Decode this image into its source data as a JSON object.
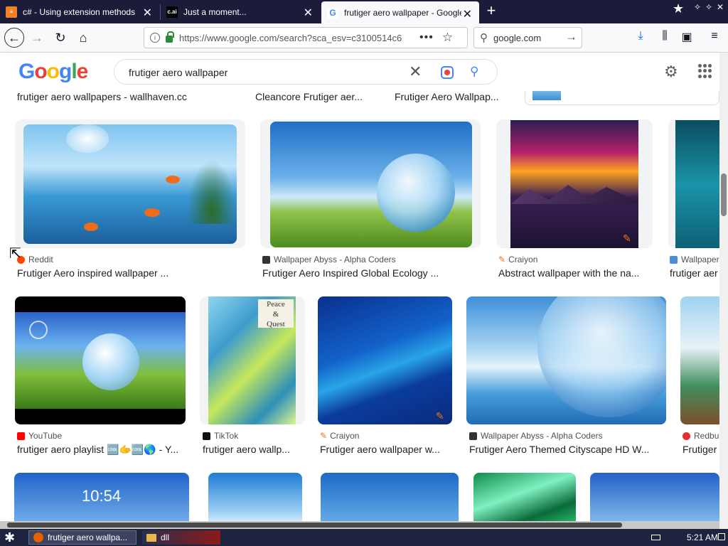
{
  "tabs": [
    {
      "title": "c# - Using extension methods in .N",
      "favicon": "stackoverflow-icon"
    },
    {
      "title": "Just a moment...",
      "favicon": "cai-icon",
      "fav_text": "c.ai"
    },
    {
      "title": "frutiger aero wallpaper - Google Se",
      "favicon": "google-icon",
      "active": true
    }
  ],
  "nav": {
    "url": "https://www.google.com/search?sca_esv=c3100514c6",
    "search_engine": "google.com"
  },
  "google": {
    "logo": "Google",
    "query": "frutiger aero wallpaper"
  },
  "top_row_captions": [
    "frutiger aero wallpapers - wallhaven.cc",
    "Cleancore Frutiger aer...",
    "Frutiger Aero Wallpap..."
  ],
  "row1": [
    {
      "source": "Reddit",
      "caption": "Frutiger Aero inspired wallpaper ...",
      "src_color": "#ff4500"
    },
    {
      "source": "Wallpaper Abyss - Alpha Coders",
      "caption": "Frutiger Aero Inspired Global Ecology ...",
      "src_color": "#333333"
    },
    {
      "source": "Craiyon",
      "caption": "Abstract wallpaper with the na...",
      "src_color": "#e8761c"
    },
    {
      "source": "Wallpaper",
      "caption": "frutiger aer",
      "src_color": "#4a90d9"
    }
  ],
  "row2": [
    {
      "source": "YouTube",
      "caption": "frutiger aero playlist 🆒🫱🆒🌎 - Y...",
      "src_color": "#ff0000"
    },
    {
      "source": "TikTok",
      "caption": "frutiger aero wallp...",
      "src_color": "#111111"
    },
    {
      "source": "Craiyon",
      "caption": "Frutiger aero wallpaper w...",
      "src_color": "#e8761c"
    },
    {
      "source": "Wallpaper Abyss - Alpha Coders",
      "caption": "Frutiger Aero Themed Cityscape HD W...",
      "src_color": "#333333"
    },
    {
      "source": "Redbu",
      "caption": "Frutiger",
      "src_color": "#e03030"
    }
  ],
  "taskbar": {
    "items": [
      "frutiger aero wallpa...",
      "dll"
    ],
    "clock": "5:21 AM"
  }
}
